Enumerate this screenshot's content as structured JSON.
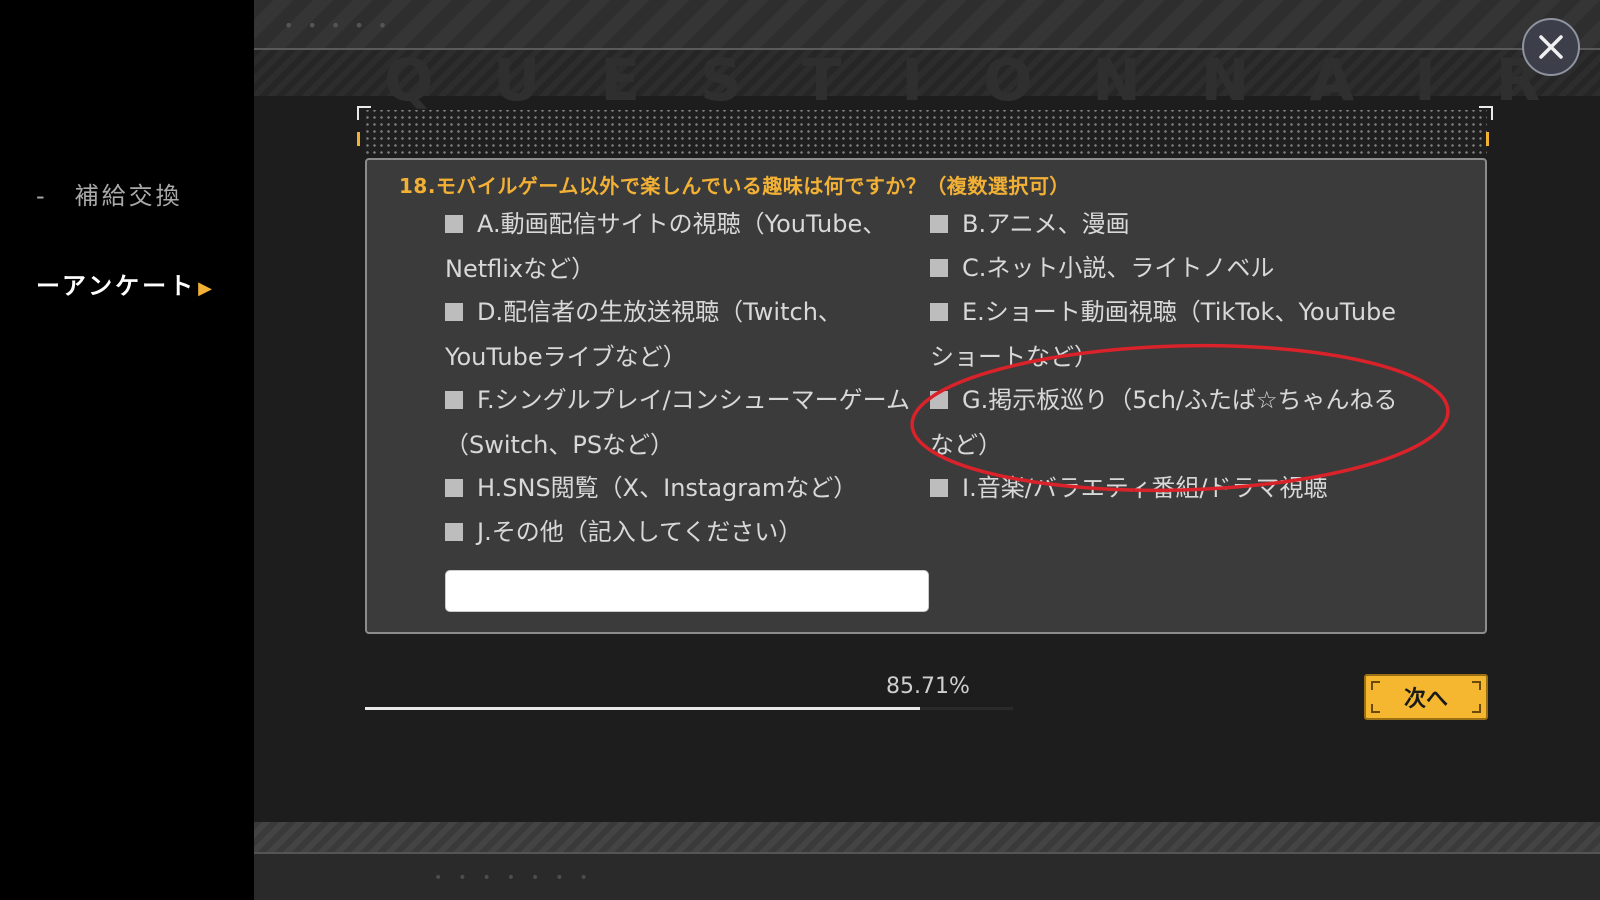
{
  "sidebar": {
    "items": [
      {
        "label": "-　補給交換",
        "active": false
      },
      {
        "label": "ーアンケート",
        "active": true
      }
    ]
  },
  "header": {
    "watermark": "QUESTIONNAIRE"
  },
  "question": {
    "title": "18.モバイルゲーム以外で楽しんでいる趣味は何ですか？（複数選択可）",
    "options": [
      {
        "id": "A",
        "label": "A.動画配信サイトの視聴（YouTube、Netflixなど）"
      },
      {
        "id": "B",
        "label": "B.アニメ、漫画"
      },
      {
        "id": "C",
        "label": "C.ネット小説、ライトノベル"
      },
      {
        "id": "D",
        "label": "D.配信者の生放送視聴（Twitch、YouTubeライブなど）"
      },
      {
        "id": "E",
        "label": "E.ショート動画視聴（TikTok、YouTubeショートなど）"
      },
      {
        "id": "F",
        "label": "F.シングルプレイ/コンシューマーゲーム（Switch、PSなど）"
      },
      {
        "id": "G",
        "label": "G.掲示板巡り（5ch/ふたば☆ちゃんねるなど）"
      },
      {
        "id": "H",
        "label": "H.SNS閲覧（X、Instagramなど）"
      },
      {
        "id": "I",
        "label": "I.音楽/バラエティ番組/ドラマ視聴"
      },
      {
        "id": "J",
        "label": "J.その他（記入してください）"
      }
    ],
    "other_input_value": ""
  },
  "progress": {
    "label": "85.71%",
    "value": 0.8571
  },
  "next_button": {
    "label": "次へ"
  },
  "colors": {
    "accent": "#f2b135",
    "highlight_circle": "#d9222a",
    "card_bg": "#3b3b3b"
  },
  "icons": {
    "close": "close-icon",
    "arrow": "play-arrow-icon"
  }
}
